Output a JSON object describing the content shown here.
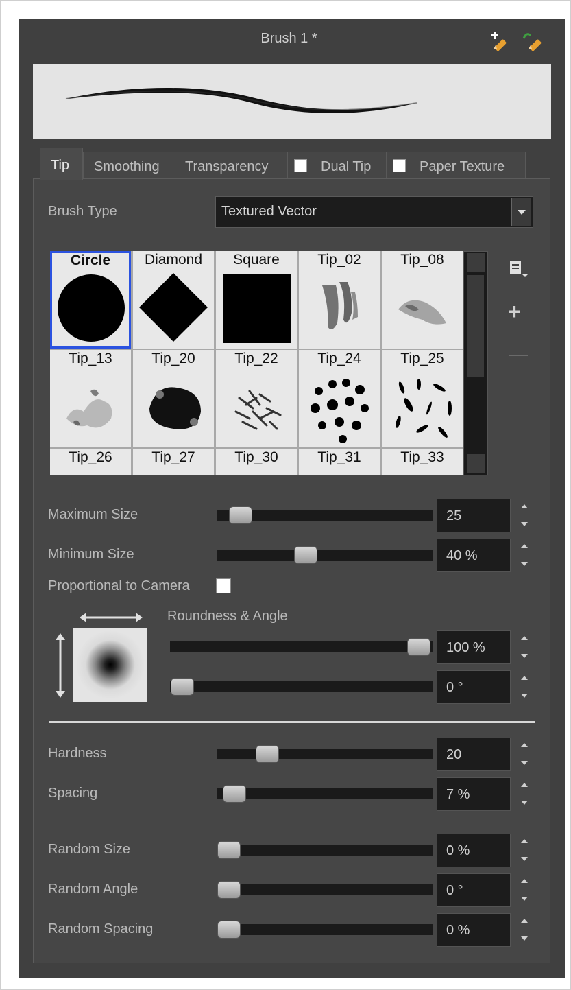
{
  "header": {
    "title": "Brush 1 *",
    "icons": [
      "new-brush-icon",
      "new-brush-from-selection-icon"
    ]
  },
  "tabs": [
    {
      "label": "Tip",
      "active": true,
      "checkbox": false
    },
    {
      "label": "Smoothing",
      "active": false,
      "checkbox": false
    },
    {
      "label": "Transparency",
      "active": false,
      "checkbox": false
    },
    {
      "label": "Dual Tip",
      "active": false,
      "checkbox": true,
      "checked": false
    },
    {
      "label": "Paper Texture",
      "active": false,
      "checkbox": true,
      "checked": false
    }
  ],
  "brush_type": {
    "label": "Brush Type",
    "value": "Textured Vector"
  },
  "tips": [
    {
      "name": "Circle",
      "selected": true
    },
    {
      "name": "Diamond"
    },
    {
      "name": "Square"
    },
    {
      "name": "Tip_02"
    },
    {
      "name": "Tip_08"
    },
    {
      "name": "Tip_13"
    },
    {
      "name": "Tip_20"
    },
    {
      "name": "Tip_22"
    },
    {
      "name": "Tip_24"
    },
    {
      "name": "Tip_25"
    },
    {
      "name": "Tip_26"
    },
    {
      "name": "Tip_27"
    },
    {
      "name": "Tip_30"
    },
    {
      "name": "Tip_31"
    },
    {
      "name": "Tip_33"
    }
  ],
  "tip_actions": {
    "menu_icon": "tip-menu-icon",
    "add": "+",
    "remove": "—"
  },
  "size": {
    "max_label": "Maximum Size",
    "max_value": "25",
    "max_slider": 0.04,
    "min_label": "Minimum Size",
    "min_value": "40 %",
    "min_slider": 0.4
  },
  "proportional": {
    "label": "Proportional to Camera",
    "checked": false
  },
  "roundness": {
    "label": "Roundness & Angle",
    "roundness_value": "100 %",
    "roundness_slider": 1.0,
    "angle_value": "0 °",
    "angle_slider": 0.0
  },
  "hardness": {
    "label": "Hardness",
    "value": "20",
    "slider": 0.2
  },
  "spacing": {
    "label": "Spacing",
    "value": "7 %",
    "slider": 0.07
  },
  "random": {
    "size_label": "Random Size",
    "size_value": "0 %",
    "angle_label": "Random Angle",
    "angle_value": "0 °",
    "spacing_label": "Random Spacing",
    "spacing_value": "0 %"
  },
  "colors": {
    "panel": "#404040",
    "selection": "#2b52e0"
  }
}
